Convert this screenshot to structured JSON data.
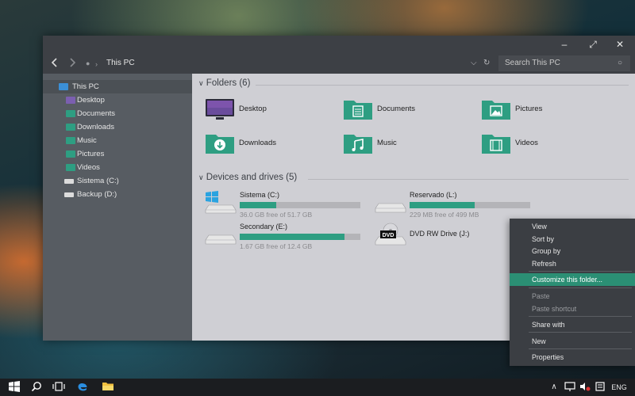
{
  "window": {
    "address_path": "This PC",
    "search_placeholder": "Search This PC",
    "minimize_glyph": "–",
    "maximize_glyph": "⤢",
    "close_glyph": "✕"
  },
  "sidebar": {
    "items": [
      {
        "label": "This PC",
        "icon": "computer-icon",
        "color": "#3b8fd6"
      },
      {
        "label": "Desktop",
        "icon": "desktop-icon",
        "color": "#7b5fb0"
      },
      {
        "label": "Documents",
        "icon": "documents-icon",
        "color": "#2e9e82"
      },
      {
        "label": "Downloads",
        "icon": "downloads-icon",
        "color": "#2e9e82"
      },
      {
        "label": "Music",
        "icon": "music-icon",
        "color": "#2e9e82"
      },
      {
        "label": "Pictures",
        "icon": "pictures-icon",
        "color": "#2e9e82"
      },
      {
        "label": "Videos",
        "icon": "videos-icon",
        "color": "#2e9e82"
      },
      {
        "label": "Sistema (C:)",
        "icon": "drive-icon",
        "color": "#dcdcdc"
      },
      {
        "label": "Backup (D:)",
        "icon": "drive-icon",
        "color": "#dcdcdc"
      }
    ]
  },
  "folders_section": {
    "title": "Folders (6)",
    "items": [
      {
        "label": "Desktop",
        "icon": "desktop-icon"
      },
      {
        "label": "Documents",
        "icon": "documents-icon"
      },
      {
        "label": "Pictures",
        "icon": "pictures-icon"
      },
      {
        "label": "Downloads",
        "icon": "downloads-icon"
      },
      {
        "label": "Music",
        "icon": "music-icon"
      },
      {
        "label": "Videos",
        "icon": "videos-icon"
      }
    ]
  },
  "drives_section": {
    "title": "Devices and drives (5)",
    "items": [
      {
        "label": "Sistema (C:)",
        "free_text": "36.0 GB free of 51.7 GB",
        "used_fraction": 0.3
      },
      {
        "label": "Reservado (L:)",
        "free_text": "229 MB free of 499 MB",
        "used_fraction": 0.54
      },
      {
        "label": "Secondary (E:)",
        "free_text": "1.67 GB free of 12.4 GB",
        "used_fraction": 0.87
      },
      {
        "label": "DVD RW Drive (J:)",
        "badge": "DVD"
      }
    ]
  },
  "context_menu": {
    "items": [
      "View",
      "Sort by",
      "Group by",
      "Refresh",
      "Customize this folder...",
      "Paste",
      "Paste shortcut",
      "Share with",
      "New",
      "Properties"
    ]
  },
  "taskbar": {
    "language": "ENG"
  },
  "colors": {
    "accent": "#2e9e82",
    "desktop_folder": "#5c4a8e"
  }
}
